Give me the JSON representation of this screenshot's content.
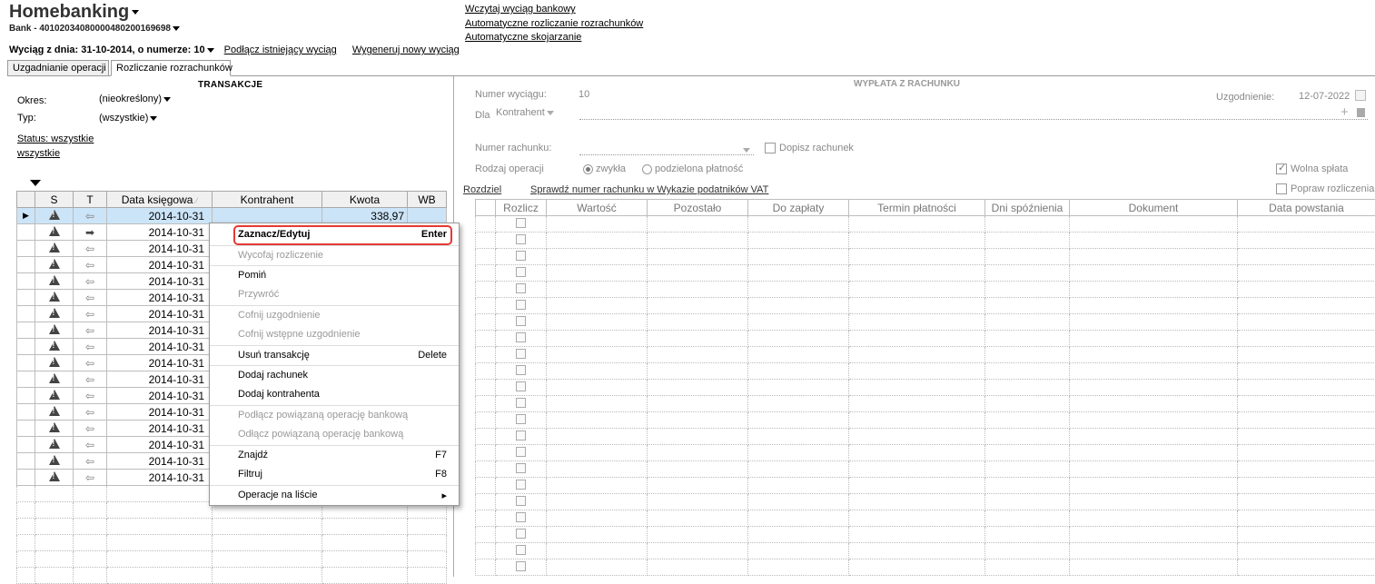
{
  "header": {
    "app_title": "Homebanking",
    "bank_line": "Bank - 40102034080000480200169698",
    "statement_text": "Wyciąg z dnia: 31-10-2014, o numerze: 10",
    "attach_link": "Podłącz istniejący wyciąg",
    "generate_link": "Wygeneruj nowy wyciąg"
  },
  "top_links": [
    "Wczytaj wyciąg bankowy",
    "Automatyczne rozliczanie rozrachunków",
    "Automatyczne skojarzanie"
  ],
  "tabs": [
    {
      "label": "Uzgadnianie operacji",
      "active": false
    },
    {
      "label": "Rozliczanie rozrachunków",
      "active": true
    }
  ],
  "left": {
    "title": "TRANSAKCJE",
    "filters": {
      "period_label": "Okres:",
      "period_value": "(nieokreślony)",
      "type_label": "Typ:",
      "type_value": "(wszystkie)",
      "status_link_1": "Status: wszystkie",
      "status_link_2": "wszystkie"
    },
    "columns": [
      "S",
      "T",
      "Data księgowa",
      "Kontrahent",
      "Kwota",
      "WB"
    ],
    "rows": [
      {
        "date": "2014-10-31",
        "dir": "in",
        "amount": "338,97",
        "selected": true
      },
      {
        "date": "2014-10-31",
        "dir": "out"
      },
      {
        "date": "2014-10-31",
        "dir": "in"
      },
      {
        "date": "2014-10-31",
        "dir": "in"
      },
      {
        "date": "2014-10-31",
        "dir": "in"
      },
      {
        "date": "2014-10-31",
        "dir": "in"
      },
      {
        "date": "2014-10-31",
        "dir": "in"
      },
      {
        "date": "2014-10-31",
        "dir": "in"
      },
      {
        "date": "2014-10-31",
        "dir": "in"
      },
      {
        "date": "2014-10-31",
        "dir": "in"
      },
      {
        "date": "2014-10-31",
        "dir": "in"
      },
      {
        "date": "2014-10-31",
        "dir": "in"
      },
      {
        "date": "2014-10-31",
        "dir": "in"
      },
      {
        "date": "2014-10-31",
        "dir": "in"
      },
      {
        "date": "2014-10-31",
        "dir": "in"
      },
      {
        "date": "2014-10-31",
        "dir": "in"
      },
      {
        "date": "2014-10-31",
        "dir": "in"
      }
    ],
    "empty_rows": 6
  },
  "context_menu": {
    "items": [
      {
        "label": "Zaznacz/Edytuj",
        "shortcut": "Enter",
        "disabled": false,
        "bold": true,
        "highlight": true
      },
      {
        "label": "Wycofaj rozliczenie",
        "shortcut": "",
        "disabled": true
      },
      {
        "label": "Pomiń",
        "shortcut": "",
        "disabled": false
      },
      {
        "label": "Przywróć",
        "shortcut": "",
        "disabled": true
      },
      {
        "label": "Cofnij uzgodnienie",
        "shortcut": "",
        "disabled": true
      },
      {
        "label": "Cofnij wstępne uzgodnienie",
        "shortcut": "",
        "disabled": true
      },
      {
        "label": "Usuń transakcję",
        "shortcut": "Delete",
        "disabled": false
      },
      {
        "label": "Dodaj rachunek",
        "shortcut": "",
        "disabled": false
      },
      {
        "label": "Dodaj kontrahenta",
        "shortcut": "",
        "disabled": false
      },
      {
        "label": "Podłącz powiązaną operację bankową",
        "shortcut": "",
        "disabled": true
      },
      {
        "label": "Odłącz powiązaną operację bankową",
        "shortcut": "",
        "disabled": true
      },
      {
        "label": "Znajdź",
        "shortcut": "F7",
        "disabled": false
      },
      {
        "label": "Filtruj",
        "shortcut": "F8",
        "disabled": false
      },
      {
        "label": "Operacje na liście",
        "shortcut": "▸",
        "disabled": false
      }
    ]
  },
  "right": {
    "title": "WYPŁATA Z RACHUNKU",
    "statement_no_label": "Numer wyciągu:",
    "statement_no_value": "10",
    "reconcile_label": "Uzgodnienie:",
    "reconcile_date": "12-07-2022",
    "for_label": "Dla",
    "for_value": "Kontrahent",
    "account_label": "Numer rachunku:",
    "add_account_label": "Dopisz rachunek",
    "op_type_label": "Rodzaj operacji",
    "op_normal": "zwykła",
    "op_split": "podzielona płatność",
    "free_payment": "Wolna spłata",
    "fix_settlements": "Popraw rozliczenia",
    "split_link": "Rozdziel",
    "vat_link": "Sprawdź numer rachunku w Wykazie podatników VAT",
    "columns": [
      "Rozlicz",
      "Wartość",
      "Pozostało",
      "Do zapłaty",
      "Termin płatności",
      "Dni spóźnienia",
      "Dokument",
      "Data powstania"
    ],
    "row_count": 22
  },
  "colors": {
    "selection": "#cce4f7",
    "highlight_border": "#e53935",
    "disabled_text": "#999999"
  }
}
